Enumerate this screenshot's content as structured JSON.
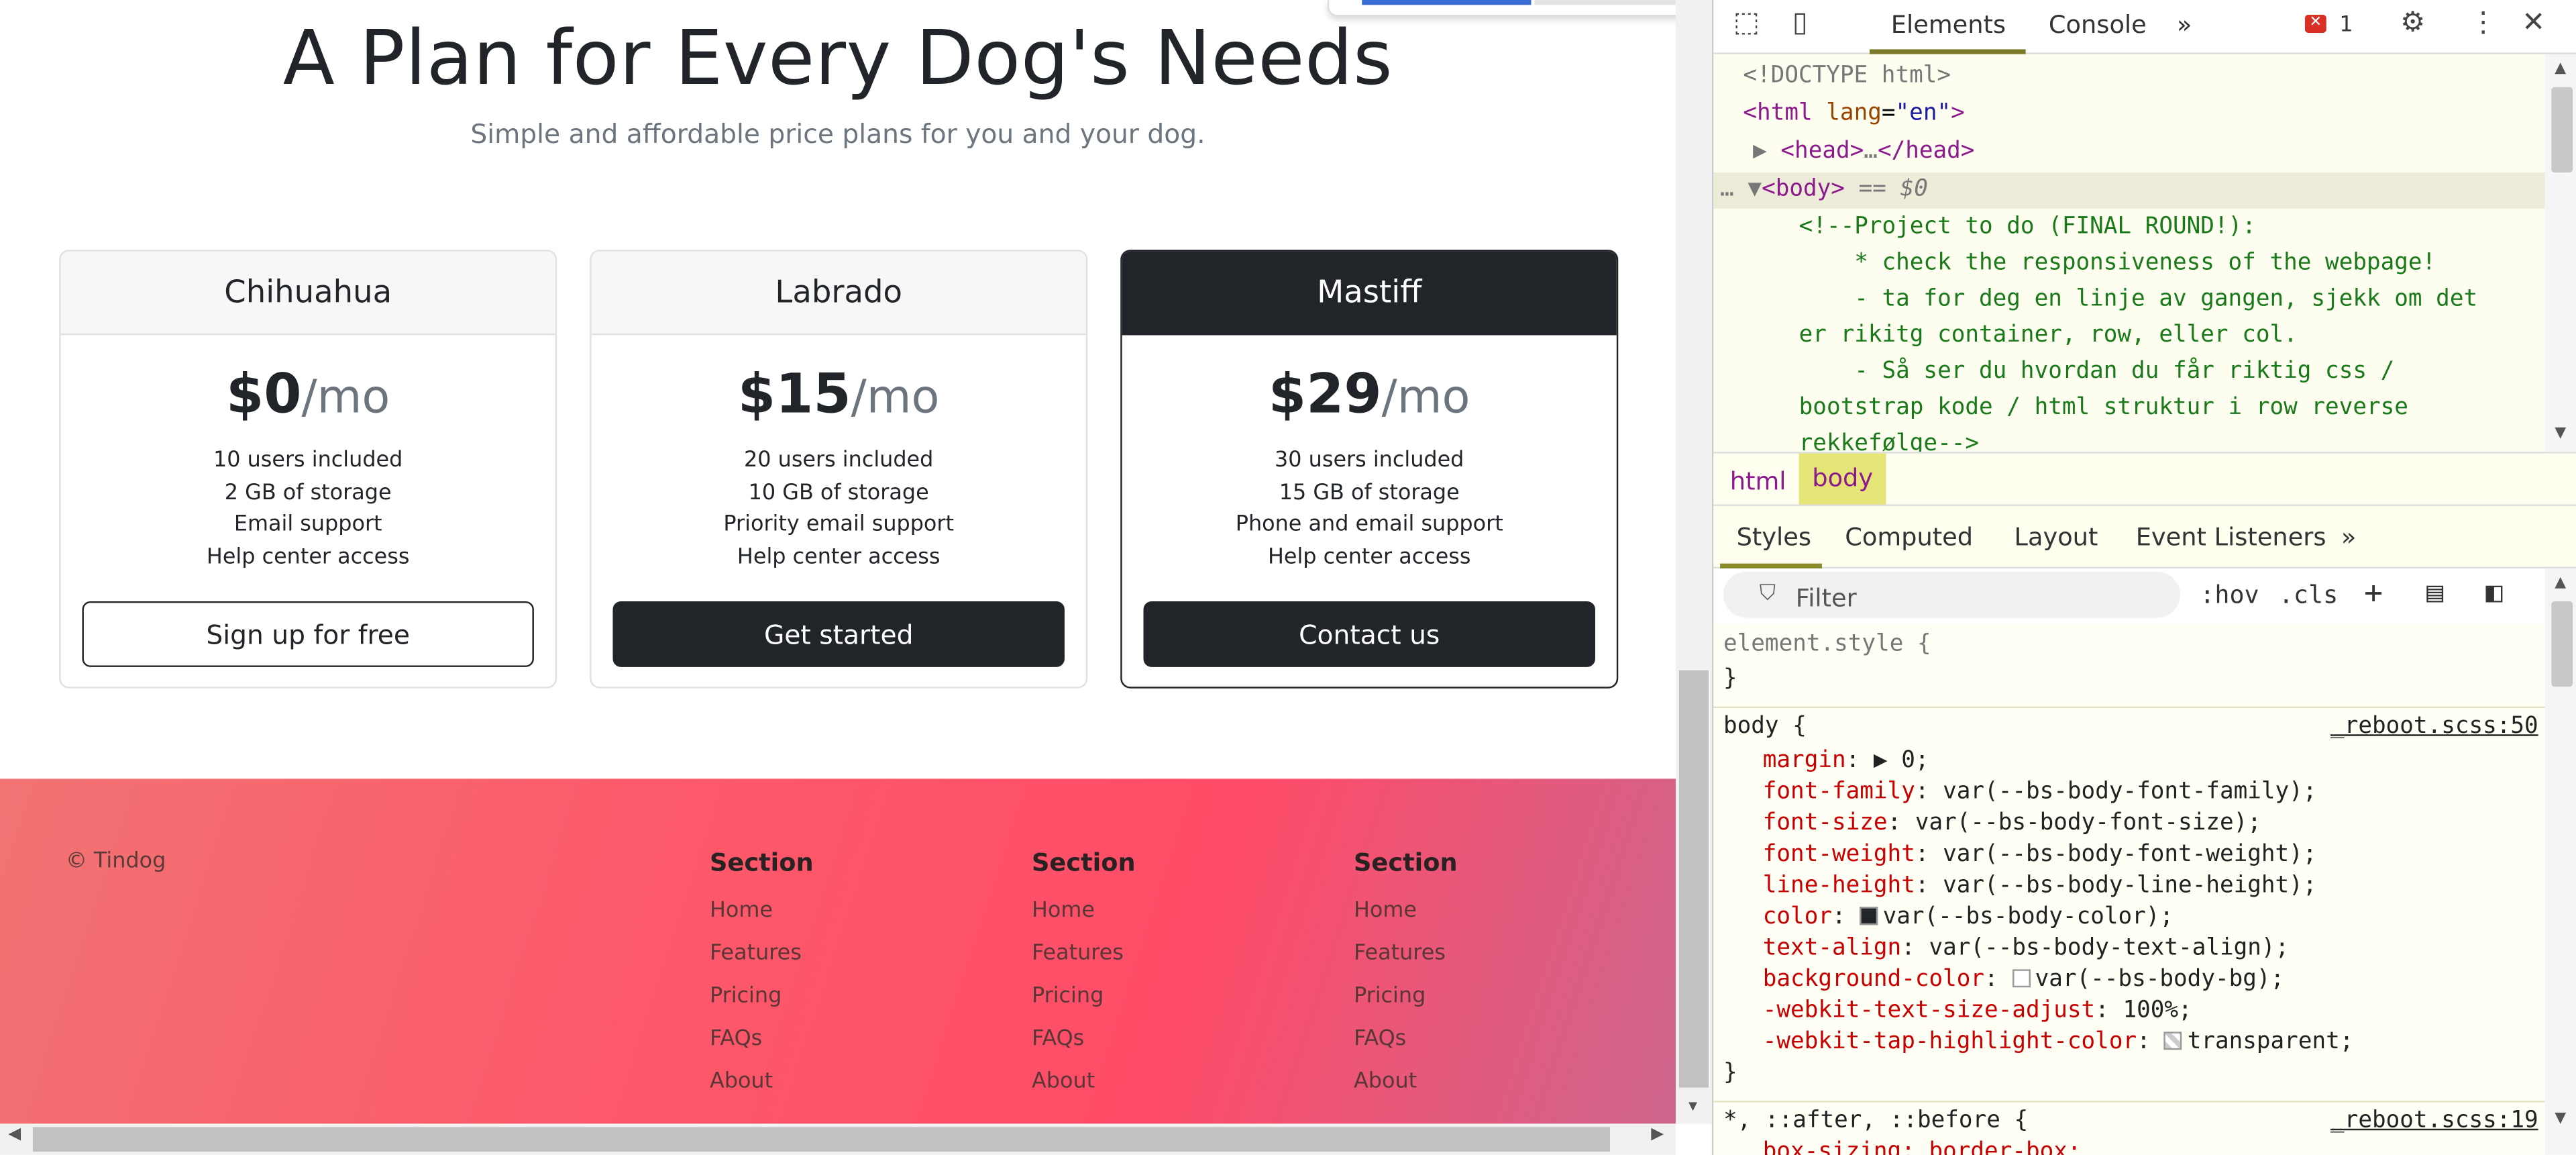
{
  "page": {
    "title": "A Plan for Every Dog's Needs",
    "subtitle": "Simple and affordable price plans for you and your dog.",
    "plans": [
      {
        "name": "Chihuahua",
        "price": "$0",
        "period": "/mo",
        "features": [
          "10 users included",
          "2 GB of storage",
          "Email support",
          "Help center access"
        ],
        "button": "Sign up for free"
      },
      {
        "name": "Labrado",
        "price": "$15",
        "period": "/mo",
        "features": [
          "20 users included",
          "10 GB of storage",
          "Priority email support",
          "Help center access"
        ],
        "button": "Get started"
      },
      {
        "name": "Mastiff",
        "price": "$29",
        "period": "/mo",
        "features": [
          "30 users included",
          "15 GB of storage",
          "Phone and email support",
          "Help center access"
        ],
        "button": "Contact us"
      }
    ],
    "footer": {
      "copyright": "© Tindog",
      "columns": [
        {
          "heading": "Section",
          "links": [
            "Home",
            "Features",
            "Pricing",
            "FAQs",
            "About"
          ]
        },
        {
          "heading": "Section",
          "links": [
            "Home",
            "Features",
            "Pricing",
            "FAQs",
            "About"
          ]
        },
        {
          "heading": "Section",
          "links": [
            "Home",
            "Features",
            "Pricing",
            "FAQs",
            "About"
          ]
        }
      ]
    }
  },
  "devtools": {
    "tabs": [
      "Elements",
      "Console"
    ],
    "more": "»",
    "error_count": "1",
    "error_badge": "✕",
    "dom": {
      "doctype": "<!DOCTYPE html>",
      "html_open": "<html",
      "html_attr": "lang",
      "html_val": "\"en\"",
      "html_close": ">",
      "head": "<head>",
      "head_ellipsis": "…",
      "head_close": "</head>",
      "body": "<body>",
      "body_suffix": "== $0",
      "ellipsis": "…",
      "comment_lines": [
        "<!--Project to do (FINAL ROUND!):",
        "    * check the responsiveness of the webpage!",
        "    - ta for deg en linje av gangen, sjekk om det",
        "er rikitg container, row, eller col.",
        "    - Så ser du hvordan du får riktig css /",
        "bootstrap kode / html struktur i row reverse",
        "rekkefølge-->"
      ]
    },
    "breadcrumbs": [
      "html",
      "body"
    ],
    "sub_tabs": [
      "Styles",
      "Computed",
      "Layout",
      "Event Listeners"
    ],
    "sub_more": "»",
    "filter_placeholder": "Filter",
    "hov": ":hov",
    "cls": ".cls",
    "plus": "+",
    "styles": {
      "element_style": "element.style {",
      "close": "}",
      "body_rule": "body {",
      "body_source": "_reboot.scss:50",
      "props": [
        {
          "name": "margin",
          "value": "0;",
          "arrow": "▶ "
        },
        {
          "name": "font-family",
          "value": "var(--bs-body-font-family);"
        },
        {
          "name": "font-size",
          "value": "var(--bs-body-font-size);"
        },
        {
          "name": "font-weight",
          "value": "var(--bs-body-font-weight);"
        },
        {
          "name": "line-height",
          "value": "var(--bs-body-line-height);"
        },
        {
          "name": "color",
          "value": "var(--bs-body-color);"
        },
        {
          "name": "text-align",
          "value": "var(--bs-body-text-align);"
        },
        {
          "name": "background-color",
          "value": "var(--bs-body-bg);"
        },
        {
          "name": "-webkit-text-size-adjust",
          "value": "100%;"
        },
        {
          "name": "-webkit-tap-highlight-color",
          "value": "transparent;"
        }
      ],
      "star_rule": "*, ::after, ::before {",
      "star_source": "_reboot.scss:19",
      "box_sizing": "box-sizing: border-box;"
    }
  }
}
